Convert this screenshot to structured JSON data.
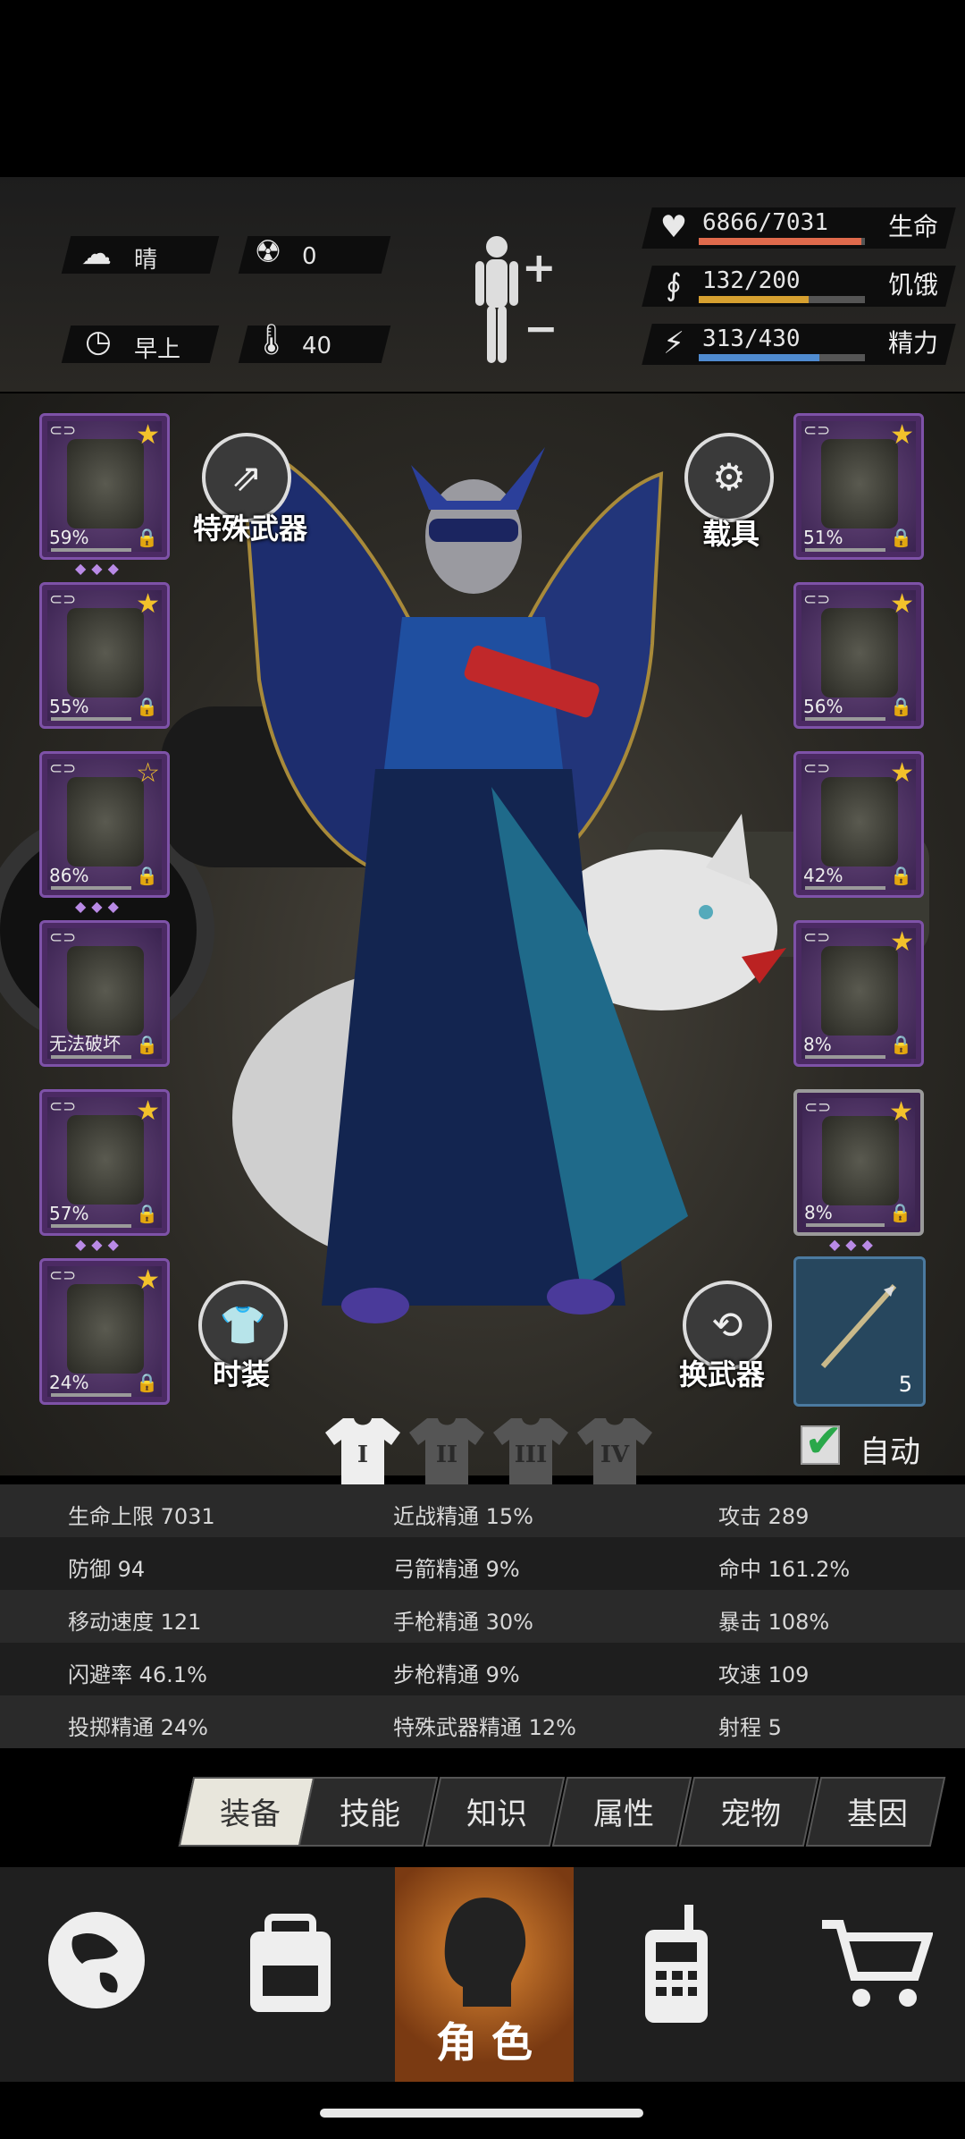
{
  "header": {
    "weather": {
      "icon": "cloud-sun-icon",
      "value": "晴"
    },
    "radiation": {
      "icon": "radiation-icon",
      "value": "0"
    },
    "time": {
      "icon": "clock-icon",
      "value": "早上"
    },
    "temperature": {
      "icon": "thermometer-icon",
      "value": "40"
    },
    "vitals": [
      {
        "label": "生命",
        "value": "6866/7031",
        "fraction": 0.976,
        "color": "#e06a4c",
        "icon": "heart-pulse-icon"
      },
      {
        "label": "饥饿",
        "value": "132/200",
        "fraction": 0.66,
        "color": "#d6a030",
        "icon": "stomach-icon"
      },
      {
        "label": "精力",
        "value": "313/430",
        "fraction": 0.728,
        "color": "#4f8bd0",
        "icon": "energy-head-icon"
      }
    ]
  },
  "left_slots": [
    {
      "name": "helmet",
      "pct": "59%",
      "star": "★",
      "gems": "◆◆◆"
    },
    {
      "name": "jacket",
      "pct": "55%",
      "star": "★",
      "gems": ""
    },
    {
      "name": "suit",
      "pct": "86%",
      "star": "☆",
      "gems": "◆◆◆"
    },
    {
      "name": "backpack",
      "pct": "无法破坏",
      "star": "",
      "gems": ""
    },
    {
      "name": "pants",
      "pct": "57%",
      "star": "★",
      "gems": "◆◆◆"
    },
    {
      "name": "boots",
      "pct": "24%",
      "star": "★",
      "gems": ""
    }
  ],
  "right_slots": [
    {
      "name": "goggles",
      "pct": "51%",
      "star": "★",
      "gems": ""
    },
    {
      "name": "gasmask",
      "pct": "56%",
      "star": "★",
      "gems": ""
    },
    {
      "name": "vest",
      "pct": "42%",
      "star": "★",
      "gems": ""
    },
    {
      "name": "shield",
      "pct": "8%",
      "star": "★",
      "gems": ""
    },
    {
      "name": "pistol",
      "pct": "8%",
      "star": "★",
      "gems": "◆◆◆"
    }
  ],
  "weapon_slot": {
    "count": "5"
  },
  "buttons": {
    "special_weapon": "特殊武器",
    "vehicle": "载具",
    "fashion": "时装",
    "switch_weapon": "换武器",
    "auto": "自动"
  },
  "outfit_tabs": [
    "I",
    "II",
    "III",
    "IV"
  ],
  "stats": [
    [
      "生命上限 7031",
      "近战精通 15%",
      "攻击 289"
    ],
    [
      "防御 94",
      "弓箭精通 9%",
      "命中 161.2%"
    ],
    [
      "移动速度 121",
      "手枪精通 30%",
      "暴击 108%"
    ],
    [
      "闪避率 46.1%",
      "步枪精通 9%",
      "攻速 109"
    ],
    [
      "投掷精通 24%",
      "特殊武器精通 12%",
      "射程 5"
    ]
  ],
  "tabs": [
    "装备",
    "技能",
    "知识",
    "属性",
    "宠物",
    "基因"
  ],
  "nav": {
    "active_label": "角 色"
  }
}
